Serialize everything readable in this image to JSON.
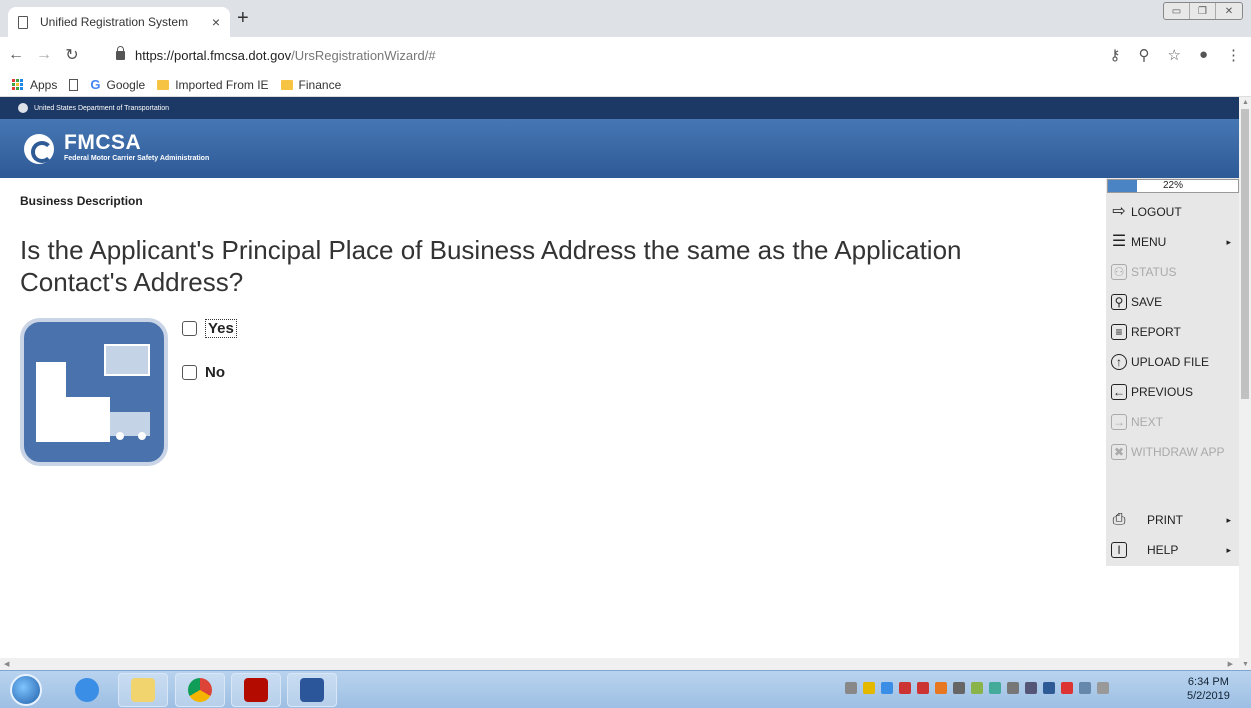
{
  "browser": {
    "tab_title": "Unified Registration System",
    "tab_close": "×",
    "new_tab": "+",
    "url_host": "https://portal.fmcsa.dot.gov",
    "url_path": "/UrsRegistrationWizard/#",
    "bookmarks": [
      "Apps",
      "Google",
      "Imported From IE",
      "Finance"
    ]
  },
  "header": {
    "dot_text": "United States Department of Transportation",
    "brand": "FMCSA",
    "brand_sub": "Federal Motor Carrier Safety Administration"
  },
  "main": {
    "section_label": "Business Description",
    "question": "Is the Applicant's Principal Place of Business Address the same as the Application Contact's Address?",
    "options": [
      {
        "label": "Yes",
        "checked": false
      },
      {
        "label": "No",
        "checked": false
      }
    ]
  },
  "sidebar": {
    "progress_text": "22%",
    "progress_value": 0.22,
    "items": [
      {
        "label": "LOGOUT",
        "icon": "logout-icon",
        "enabled": true
      },
      {
        "label": "MENU",
        "icon": "menu-icon",
        "enabled": true
      },
      {
        "label": "STATUS",
        "icon": "status-icon",
        "enabled": false
      },
      {
        "label": "SAVE",
        "icon": "save-icon",
        "enabled": true
      },
      {
        "label": "REPORT",
        "icon": "report-icon",
        "enabled": true
      },
      {
        "label": "UPLOAD FILE",
        "icon": "upload-icon",
        "enabled": true
      },
      {
        "label": "PREVIOUS",
        "icon": "previous-icon",
        "enabled": true
      },
      {
        "label": "NEXT",
        "icon": "next-icon",
        "enabled": false
      },
      {
        "label": "WITHDRAW APP",
        "icon": "withdraw-icon",
        "enabled": false
      },
      {
        "label": "PRINT",
        "icon": "print-icon",
        "enabled": true
      },
      {
        "label": "HELP",
        "icon": "help-icon",
        "enabled": true
      }
    ]
  },
  "taskbar": {
    "time": "6:34 PM",
    "date": "5/2/2019"
  }
}
